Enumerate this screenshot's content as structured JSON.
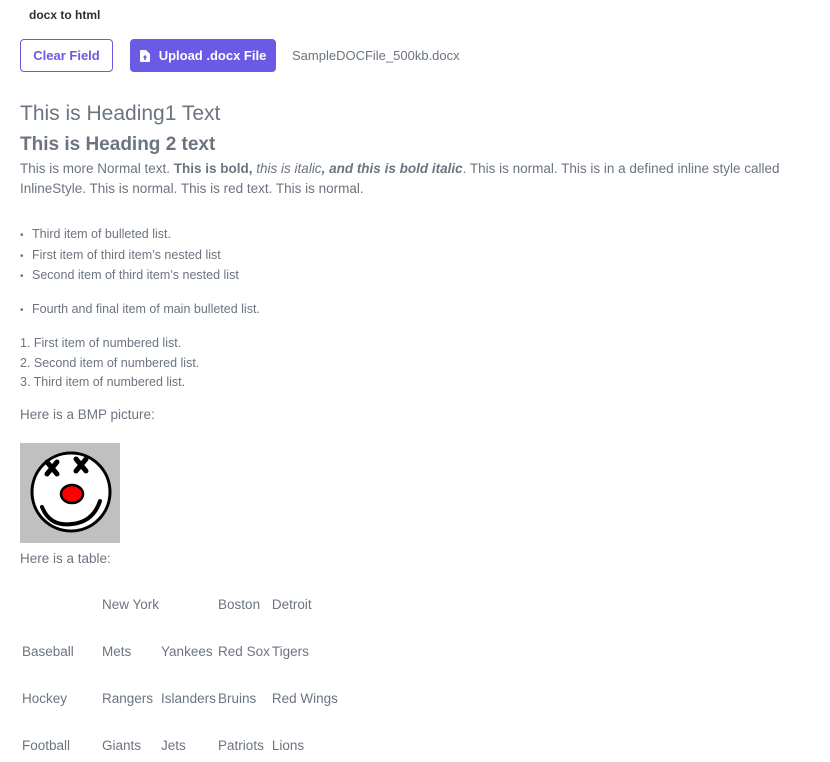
{
  "app": {
    "title": "docx to html"
  },
  "toolbar": {
    "clear_label": "Clear Field",
    "upload_label": "Upload .docx File",
    "filename": "SampleDOCFile_500kb.docx",
    "accent_color": "#6b5ae3"
  },
  "document": {
    "heading1": "This is Heading1 Text",
    "heading2": "This is Heading 2 text",
    "para": {
      "normal1": "This is more Normal text. ",
      "bold": "This is bold, ",
      "italic": "this is italic",
      "bold_italic": ", and this is bold italic",
      "normal2": ". This is normal. This is in a defined inline style called InlineStyle. This is normal. This is red text. This is normal."
    },
    "bullets_nested": [
      "Third item of bulleted list.",
      "First item of third item’s nested list",
      "Second item of third item’s nested list"
    ],
    "bullet_final": "Fourth and final item of main bulleted list.",
    "numbered": [
      "1. First item of numbered list.",
      "2. Second item of numbered list.",
      "3. Third item of numbered list."
    ],
    "picture_caption": "Here is a BMP picture:",
    "picture_icon": "clown-face-image",
    "table_caption": "Here is a table:",
    "table": {
      "header": [
        "",
        "New York",
        "",
        "Boston",
        "Detroit"
      ],
      "rows": [
        [
          "Baseball",
          "Mets",
          "Yankees",
          "Red Sox",
          "Tigers"
        ],
        [
          "Hockey",
          "Rangers",
          "Islanders",
          "Bruins",
          "Red Wings"
        ],
        [
          "Football",
          "Giants",
          "Jets",
          "Patriots",
          "Lions"
        ]
      ]
    }
  }
}
